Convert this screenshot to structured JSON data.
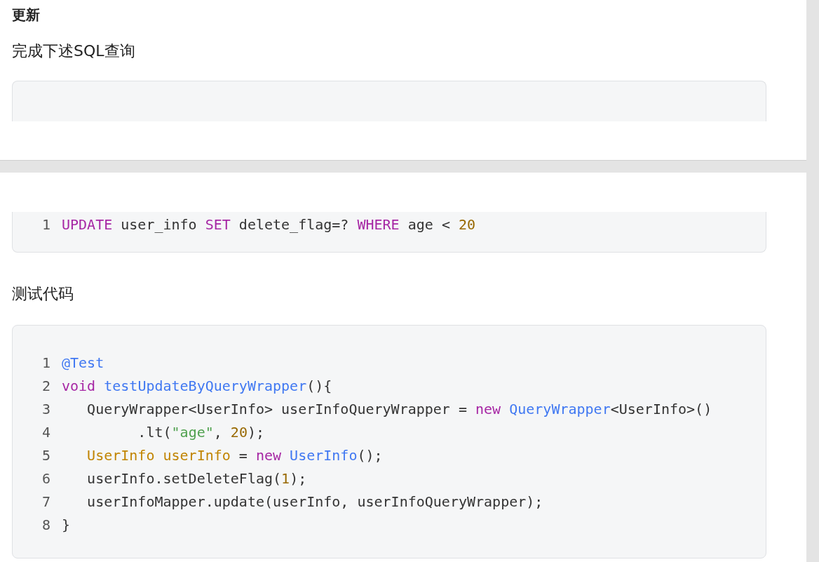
{
  "pages": [
    {
      "heading": "更新",
      "paragraph": "完成下述SQL查询"
    },
    {
      "code_lines": [
        {
          "number": "1",
          "tokens": [
            {
              "kind": "keyword",
              "text": "UPDATE"
            },
            {
              "kind": "plain",
              "text": " user_info "
            },
            {
              "kind": "keyword",
              "text": "SET"
            },
            {
              "kind": "plain",
              "text": " delete_flag=? "
            },
            {
              "kind": "keyword",
              "text": "WHERE"
            },
            {
              "kind": "plain",
              "text": " age < "
            },
            {
              "kind": "number",
              "text": "20"
            }
          ]
        }
      ],
      "paragraph": "测试代码",
      "code_lines_2": [
        {
          "number": "1",
          "tokens": [
            {
              "kind": "type",
              "text": "@Test"
            }
          ]
        },
        {
          "number": "2",
          "tokens": [
            {
              "kind": "keyword",
              "text": "void"
            },
            {
              "kind": "type",
              "text": " testUpdateByQueryWrapper"
            },
            {
              "kind": "plain",
              "text": "(){"
            }
          ]
        },
        {
          "number": "3",
          "tokens": [
            {
              "kind": "plain",
              "text": "   QueryWrapper<UserInfo> userInfoQueryWrapper = "
            },
            {
              "kind": "keyword",
              "text": "new"
            },
            {
              "kind": "type",
              "text": " QueryWrapper"
            },
            {
              "kind": "plain",
              "text": "<UserInfo>()"
            }
          ]
        },
        {
          "number": "4",
          "tokens": [
            {
              "kind": "plain",
              "text": "         .lt("
            },
            {
              "kind": "string",
              "text": "\"age\""
            },
            {
              "kind": "plain",
              "text": ", "
            },
            {
              "kind": "number",
              "text": "20"
            },
            {
              "kind": "plain",
              "text": ");"
            }
          ]
        },
        {
          "number": "5",
          "tokens": [
            {
              "kind": "variable",
              "text": "   UserInfo userInfo"
            },
            {
              "kind": "plain",
              "text": " = "
            },
            {
              "kind": "keyword",
              "text": "new"
            },
            {
              "kind": "type",
              "text": " UserInfo"
            },
            {
              "kind": "plain",
              "text": "();"
            }
          ]
        },
        {
          "number": "6",
          "tokens": [
            {
              "kind": "plain",
              "text": "   userInfo.setDeleteFlag("
            },
            {
              "kind": "number",
              "text": "1"
            },
            {
              "kind": "plain",
              "text": ");"
            }
          ]
        },
        {
          "number": "7",
          "tokens": [
            {
              "kind": "plain",
              "text": "   userInfoMapper.update(userInfo, userInfoQueryWrapper);"
            }
          ]
        },
        {
          "number": "8",
          "tokens": [
            {
              "kind": "plain",
              "text": "}"
            }
          ]
        }
      ]
    }
  ]
}
